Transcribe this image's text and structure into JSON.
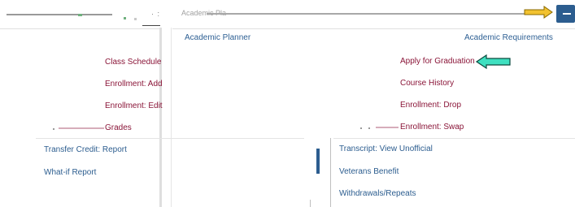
{
  "header": {
    "breadcrumb_glyph": "· :",
    "title_fragment": "Academic Pla"
  },
  "sections": {
    "planner_title": "Academic Planner",
    "requirements_title": "Academic Requirements"
  },
  "left_links": [
    {
      "label": "Class Schedule"
    },
    {
      "label": "Enrollment: Add"
    },
    {
      "label": "Enrollment: Edit"
    },
    {
      "label": "Grades"
    },
    {
      "label": "Transfer Credit: Report"
    },
    {
      "label": "What-if Report"
    }
  ],
  "right_links": [
    {
      "label": "Apply for Graduation"
    },
    {
      "label": "Course History"
    },
    {
      "label": "Enrollment: Drop"
    },
    {
      "label": "Enrollment: Swap"
    },
    {
      "label": "Transcript: View Unofficial"
    },
    {
      "label": "Veterans Benefit"
    },
    {
      "label": "Withdrawals/Repeats"
    }
  ],
  "colors": {
    "link_maroon": "#8a1538",
    "link_blue": "#2c5d8f",
    "pointer_arrow": "#3fe0c0",
    "top_arrow": "#f2c230",
    "header_button": "#2c5d8f"
  },
  "icons": {
    "pointer": "arrow-left-icon",
    "top_pointer": "arrow-right-icon",
    "menu_button": "menu-icon"
  }
}
